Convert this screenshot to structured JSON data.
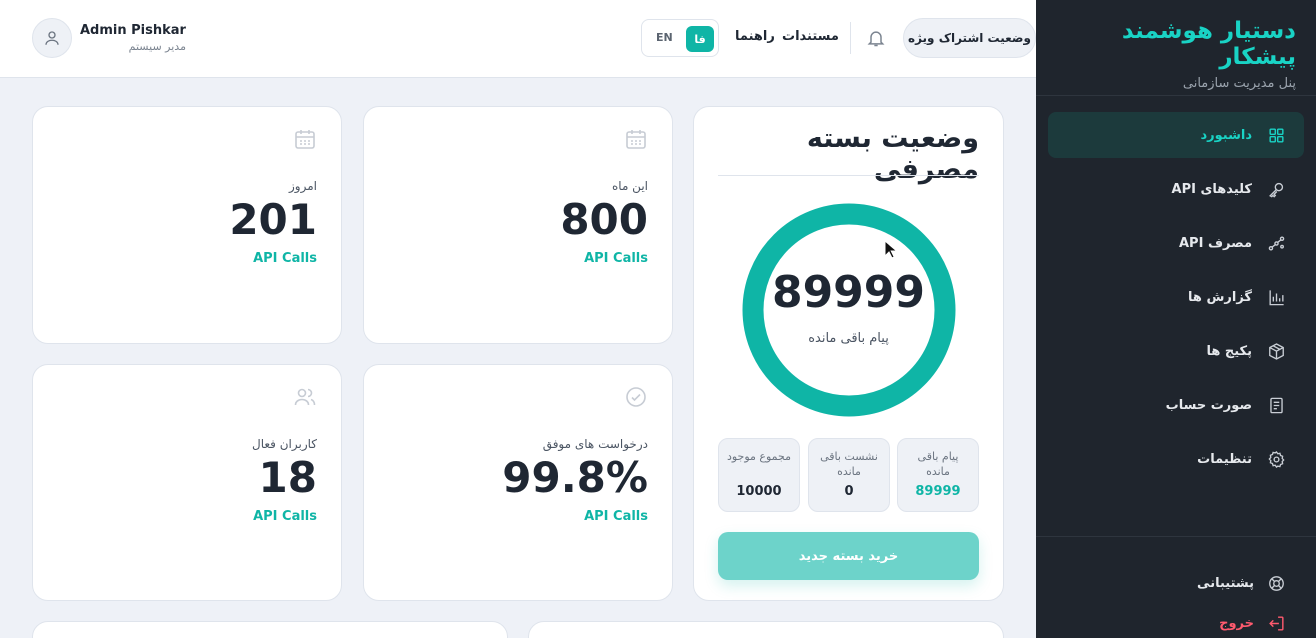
{
  "sidebar": {
    "brand_title": "دستیار هوشمند پیشکار",
    "brand_subtitle": "پنل مدیریت سازمانی",
    "items": [
      {
        "label": "داشبورد",
        "icon": "grid-icon",
        "active": true
      },
      {
        "label": "کلیدهای API",
        "icon": "key-icon"
      },
      {
        "label": "مصرف API",
        "icon": "route-icon"
      },
      {
        "label": "گزارش ها",
        "icon": "bar-chart-icon"
      },
      {
        "label": "پکیج ها",
        "icon": "package-icon"
      },
      {
        "label": "صورت حساب",
        "icon": "invoice-icon"
      },
      {
        "label": "تنظیمات",
        "icon": "gear-icon"
      }
    ],
    "support_label": "پشتیبانی",
    "logout_label": "خروج"
  },
  "header": {
    "user_name": "Admin Pishkar",
    "user_role": "مدیر سیستم",
    "subscription_label": "وضعیت اشتراک ویژه",
    "docs_label": "مستندات",
    "guide_label": "راهنما",
    "lang_en": "EN",
    "lang_fa": "فا"
  },
  "stats": [
    {
      "label": "امروز",
      "value": "201",
      "unit": "API Calls",
      "icon": "calendar-icon"
    },
    {
      "label": "این ماه",
      "value": "800",
      "unit": "API Calls",
      "icon": "calendar-icon"
    },
    {
      "label": "کاربران فعال",
      "value": "18",
      "unit": "API Calls",
      "icon": "users-icon"
    },
    {
      "label": "درخواست های موفق",
      "value": "99.8%",
      "unit": "API Calls",
      "icon": "check-circle-icon"
    }
  ],
  "package": {
    "title": "وضعیت بسته مصرفی",
    "remaining_value": "89999",
    "remaining_label": "پیام باقی مانده",
    "minis": [
      {
        "label": "پیام باقی مانده",
        "value": "89999"
      },
      {
        "label": "نشست باقی مانده",
        "value": "0"
      },
      {
        "label": "مجموع موجود",
        "value": "10000"
      }
    ],
    "buy_label": "خرید بسته جدید"
  },
  "colors": {
    "accent": "#0fb5a6",
    "sidebar_bg": "#1f252d",
    "logout": "#ff5a6e"
  }
}
